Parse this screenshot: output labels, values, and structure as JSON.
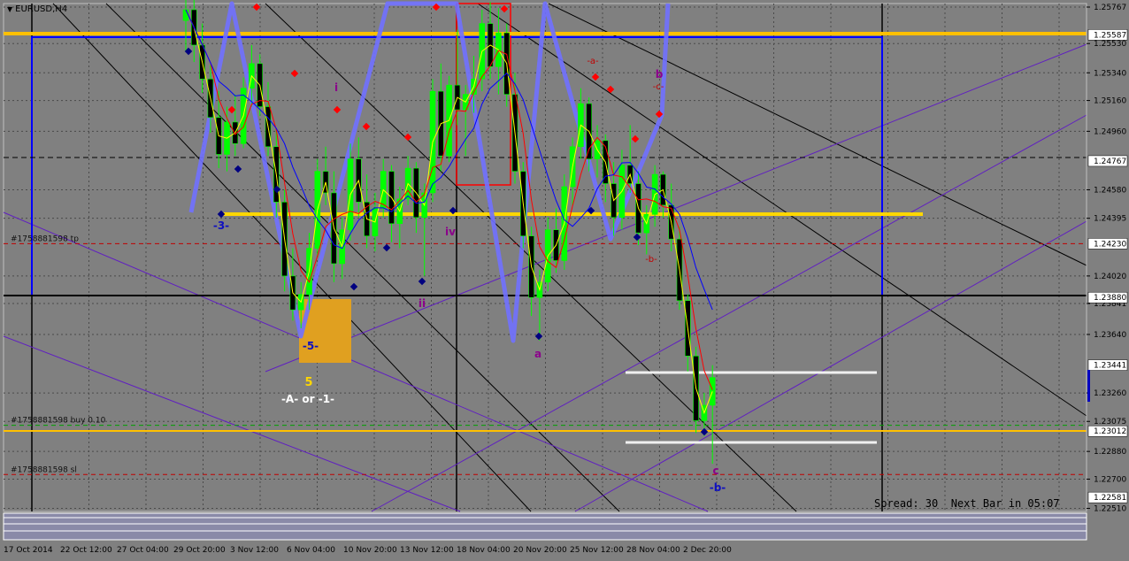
{
  "window": {
    "symbol_title": "EURUSD,H4"
  },
  "spread_text": "Spread: 30  Next Bar in 05:07",
  "chart_data": {
    "type": "candlestick",
    "title": "EURUSD,H4",
    "ylim": [
      1.2249,
      1.2579
    ],
    "price_ticks": [
      {
        "label": "1.25767",
        "value": 1.25767
      },
      {
        "label": "1.25530",
        "value": 1.2553
      },
      {
        "label": "1.25340",
        "value": 1.2534
      },
      {
        "label": "1.25160",
        "value": 1.2516
      },
      {
        "label": "1.24960",
        "value": 1.2496
      },
      {
        "label": "1.24580",
        "value": 1.2458
      },
      {
        "label": "1.24395",
        "value": 1.24395
      },
      {
        "label": "1.24020",
        "value": 1.2402
      },
      {
        "label": "1.23841",
        "value": 1.23841
      },
      {
        "label": "1.23640",
        "value": 1.2364
      },
      {
        "label": "1.23260",
        "value": 1.2326
      },
      {
        "label": "1.23075",
        "value": 1.23075
      },
      {
        "label": "1.22880",
        "value": 1.2288
      },
      {
        "label": "1.22700",
        "value": 1.227
      },
      {
        "label": "1.22510",
        "value": 1.2251
      }
    ],
    "price_tags": [
      {
        "label": "1.25587",
        "value": 1.25587,
        "color": "#ffffff"
      },
      {
        "label": "1.24767",
        "value": 1.24767,
        "color": "#ffffff"
      },
      {
        "label": "1.24230",
        "value": 1.2423,
        "color": "#ffffff"
      },
      {
        "label": "1.23880",
        "value": 1.2388,
        "color": "#ffffff"
      },
      {
        "label": "1.23441",
        "value": 1.23441,
        "color": "#ffffff"
      },
      {
        "label": "1.23012",
        "value": 1.23012,
        "color": "#ffffff"
      },
      {
        "label": "1.22581",
        "value": 1.22581,
        "color": "#ffffff"
      }
    ],
    "x_ticks": [
      "17 Oct 2014",
      "22 Oct 12:00",
      "27 Oct 04:00",
      "29 Oct 20:00",
      "3 Nov 12:00",
      "6 Nov 04:00",
      "10 Nov 20:00",
      "13 Nov 12:00",
      "18 Nov 04:00",
      "20 Nov 20:00",
      "25 Nov 12:00",
      "28 Nov 04:00",
      "2 Dec 20:00"
    ],
    "candles": [
      {
        "o": 1.2568,
        "h": 1.2585,
        "l": 1.2548,
        "c": 1.2575
      },
      {
        "o": 1.2575,
        "h": 1.2592,
        "l": 1.2541,
        "c": 1.2552
      },
      {
        "o": 1.2552,
        "h": 1.2566,
        "l": 1.2521,
        "c": 1.253
      },
      {
        "o": 1.253,
        "h": 1.2539,
        "l": 1.2495,
        "c": 1.2505
      },
      {
        "o": 1.2505,
        "h": 1.2522,
        "l": 1.2472,
        "c": 1.2481
      },
      {
        "o": 1.2481,
        "h": 1.2512,
        "l": 1.247,
        "c": 1.2502
      },
      {
        "o": 1.2502,
        "h": 1.252,
        "l": 1.248,
        "c": 1.2488
      },
      {
        "o": 1.2488,
        "h": 1.2531,
        "l": 1.2485,
        "c": 1.2524
      },
      {
        "o": 1.2524,
        "h": 1.2552,
        "l": 1.2512,
        "c": 1.254
      },
      {
        "o": 1.254,
        "h": 1.2546,
        "l": 1.2506,
        "c": 1.2512
      },
      {
        "o": 1.2512,
        "h": 1.2528,
        "l": 1.248,
        "c": 1.2486
      },
      {
        "o": 1.2486,
        "h": 1.2498,
        "l": 1.244,
        "c": 1.245
      },
      {
        "o": 1.245,
        "h": 1.2458,
        "l": 1.2392,
        "c": 1.2402
      },
      {
        "o": 1.2402,
        "h": 1.242,
        "l": 1.2373,
        "c": 1.238
      },
      {
        "o": 1.238,
        "h": 1.2398,
        "l": 1.2368,
        "c": 1.239
      },
      {
        "o": 1.239,
        "h": 1.243,
        "l": 1.238,
        "c": 1.242
      },
      {
        "o": 1.242,
        "h": 1.2478,
        "l": 1.2414,
        "c": 1.247
      },
      {
        "o": 1.247,
        "h": 1.2486,
        "l": 1.2448,
        "c": 1.2456
      },
      {
        "o": 1.2456,
        "h": 1.247,
        "l": 1.2398,
        "c": 1.241
      },
      {
        "o": 1.241,
        "h": 1.244,
        "l": 1.24,
        "c": 1.2432
      },
      {
        "o": 1.2432,
        "h": 1.2488,
        "l": 1.2425,
        "c": 1.2478
      },
      {
        "o": 1.2478,
        "h": 1.2492,
        "l": 1.244,
        "c": 1.245
      },
      {
        "o": 1.245,
        "h": 1.2468,
        "l": 1.242,
        "c": 1.2428
      },
      {
        "o": 1.2428,
        "h": 1.2456,
        "l": 1.2418,
        "c": 1.2446
      },
      {
        "o": 1.2446,
        "h": 1.2478,
        "l": 1.244,
        "c": 1.247
      },
      {
        "o": 1.247,
        "h": 1.2474,
        "l": 1.2424,
        "c": 1.2436
      },
      {
        "o": 1.2436,
        "h": 1.246,
        "l": 1.242,
        "c": 1.2452
      },
      {
        "o": 1.2452,
        "h": 1.248,
        "l": 1.2448,
        "c": 1.2472
      },
      {
        "o": 1.2472,
        "h": 1.2476,
        "l": 1.243,
        "c": 1.244
      },
      {
        "o": 1.244,
        "h": 1.2462,
        "l": 1.2402,
        "c": 1.2456
      },
      {
        "o": 1.2456,
        "h": 1.253,
        "l": 1.245,
        "c": 1.2522
      },
      {
        "o": 1.2522,
        "h": 1.254,
        "l": 1.247,
        "c": 1.248
      },
      {
        "o": 1.248,
        "h": 1.2532,
        "l": 1.2476,
        "c": 1.2526
      },
      {
        "o": 1.2526,
        "h": 1.2562,
        "l": 1.25,
        "c": 1.251
      },
      {
        "o": 1.251,
        "h": 1.2526,
        "l": 1.248,
        "c": 1.252
      },
      {
        "o": 1.252,
        "h": 1.2545,
        "l": 1.2508,
        "c": 1.253
      },
      {
        "o": 1.253,
        "h": 1.2575,
        "l": 1.2522,
        "c": 1.2566
      },
      {
        "o": 1.2566,
        "h": 1.258,
        "l": 1.253,
        "c": 1.2538
      },
      {
        "o": 1.2538,
        "h": 1.2576,
        "l": 1.252,
        "c": 1.256
      },
      {
        "o": 1.256,
        "h": 1.2566,
        "l": 1.2512,
        "c": 1.252
      },
      {
        "o": 1.252,
        "h": 1.2534,
        "l": 1.2462,
        "c": 1.247
      },
      {
        "o": 1.247,
        "h": 1.2476,
        "l": 1.242,
        "c": 1.2428
      },
      {
        "o": 1.2428,
        "h": 1.2434,
        "l": 1.2376,
        "c": 1.2388
      },
      {
        "o": 1.2388,
        "h": 1.2406,
        "l": 1.236,
        "c": 1.2398
      },
      {
        "o": 1.2398,
        "h": 1.244,
        "l": 1.2392,
        "c": 1.2432
      },
      {
        "o": 1.2432,
        "h": 1.2446,
        "l": 1.2404,
        "c": 1.2412
      },
      {
        "o": 1.2412,
        "h": 1.2468,
        "l": 1.2406,
        "c": 1.246
      },
      {
        "o": 1.246,
        "h": 1.2492,
        "l": 1.2448,
        "c": 1.2486
      },
      {
        "o": 1.2486,
        "h": 1.2524,
        "l": 1.2478,
        "c": 1.2514
      },
      {
        "o": 1.2514,
        "h": 1.2518,
        "l": 1.247,
        "c": 1.2478
      },
      {
        "o": 1.2478,
        "h": 1.25,
        "l": 1.2466,
        "c": 1.249
      },
      {
        "o": 1.249,
        "h": 1.2494,
        "l": 1.245,
        "c": 1.2462
      },
      {
        "o": 1.2462,
        "h": 1.2476,
        "l": 1.2428,
        "c": 1.244
      },
      {
        "o": 1.244,
        "h": 1.2484,
        "l": 1.2432,
        "c": 1.2474
      },
      {
        "o": 1.2474,
        "h": 1.25,
        "l": 1.2456,
        "c": 1.2462
      },
      {
        "o": 1.2462,
        "h": 1.247,
        "l": 1.2422,
        "c": 1.243
      },
      {
        "o": 1.243,
        "h": 1.2448,
        "l": 1.2416,
        "c": 1.2442
      },
      {
        "o": 1.2442,
        "h": 1.2474,
        "l": 1.2434,
        "c": 1.2468
      },
      {
        "o": 1.2468,
        "h": 1.247,
        "l": 1.244,
        "c": 1.2448
      },
      {
        "o": 1.2448,
        "h": 1.2462,
        "l": 1.2418,
        "c": 1.2426
      },
      {
        "o": 1.2426,
        "h": 1.2434,
        "l": 1.238,
        "c": 1.2386
      },
      {
        "o": 1.2386,
        "h": 1.239,
        "l": 1.234,
        "c": 1.235
      },
      {
        "o": 1.235,
        "h": 1.2356,
        "l": 1.23,
        "c": 1.2308
      },
      {
        "o": 1.2308,
        "h": 1.2326,
        "l": 1.2298,
        "c": 1.2318
      },
      {
        "o": 1.2318,
        "h": 1.2344,
        "l": 1.228,
        "c": 1.2336
      }
    ],
    "legs": [
      {
        "text": "-3-",
        "color": "#1010c0"
      },
      {
        "text": "i",
        "color": "#8b008b"
      },
      {
        "text": "ii",
        "color": "#8b008b"
      },
      {
        "text": "iv",
        "color": "#8b008b"
      },
      {
        "text": "-5-",
        "color": "#1010c0"
      },
      {
        "text": "5",
        "color": "#ffd700"
      },
      {
        "text": "-A- or -1-",
        "color": "#ffffff"
      },
      {
        "text": "a",
        "color": "#8b008b"
      },
      {
        "text": "-a-",
        "color": "#c00000"
      },
      {
        "text": "b",
        "color": "#8b008b"
      },
      {
        "text": "-c-",
        "color": "#c00000"
      },
      {
        "text": "-b-",
        "color": "#c00000"
      },
      {
        "text": "c",
        "color": "#8b008b"
      },
      {
        "text": "-b-",
        "color": "#1010c0"
      }
    ],
    "orders": [
      {
        "text": "#1758881598 tp",
        "value": 1.2423
      },
      {
        "text": "#1758881598 buy 0.10",
        "value": 1.2305
      },
      {
        "text": "#1758881598 sl",
        "value": 1.2273
      }
    ],
    "colors": {
      "background": "#808080",
      "bull": "#00ff00",
      "bear": "#000000",
      "ma_fast": "#ffff00",
      "ma_mid": "#ff0000",
      "ma_slow": "#0000ff",
      "zigzag": "#7070ff",
      "level_gold": "#ffc000",
      "rect_blue": "#0000ff",
      "rect_red": "#ff0000"
    }
  }
}
